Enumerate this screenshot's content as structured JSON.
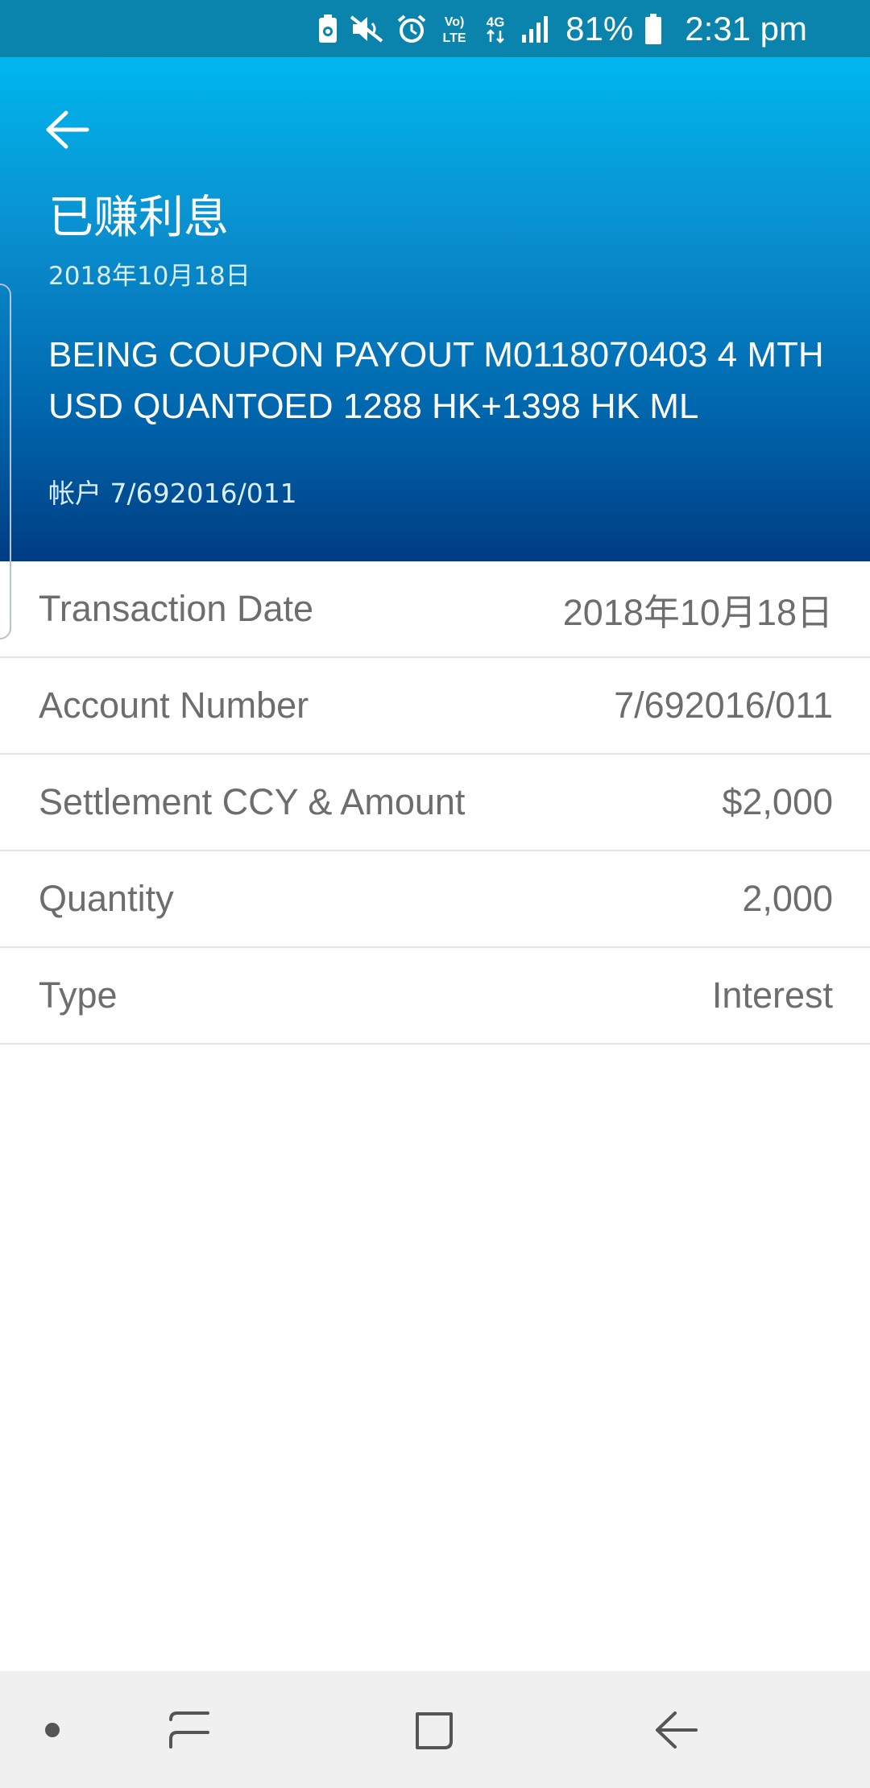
{
  "status_bar": {
    "battery_percent": "81%",
    "time": "2:31 pm",
    "network_label": "4G",
    "volte_label_top": "Vo)",
    "volte_label_bottom": "LTE"
  },
  "header": {
    "title": "已赚利息",
    "date": "2018年10月18日",
    "description": "BEING COUPON PAYOUT M0118070403 4 MTH USD QUANTOED 1288 HK+1398 HK ML",
    "account": "帐户 7/692016/011"
  },
  "details": [
    {
      "label": "Transaction Date",
      "value": "2018年10月18日"
    },
    {
      "label": "Account Number",
      "value": "7/692016/011"
    },
    {
      "label": "Settlement CCY & Amount",
      "value": "$2,000"
    },
    {
      "label": "Quantity",
      "value": "2,000"
    },
    {
      "label": "Type",
      "value": "Interest"
    }
  ],
  "colors": {
    "status_bar": "#0a84ad",
    "header_top": "#00b7ee",
    "header_bottom": "#003d83",
    "label_text": "#6d6d6d",
    "divider": "#e3e3e3",
    "nav_bar": "#f0f0f0"
  },
  "icons": {
    "status": [
      "battery-saver-icon",
      "mute-icon",
      "alarm-icon",
      "volte-icon",
      "data-arrows-icon",
      "signal-icon",
      "battery-icon"
    ],
    "header": [
      "back-arrow-icon"
    ],
    "nav": [
      "dot-icon",
      "recent-apps-icon",
      "home-icon",
      "back-icon"
    ]
  }
}
